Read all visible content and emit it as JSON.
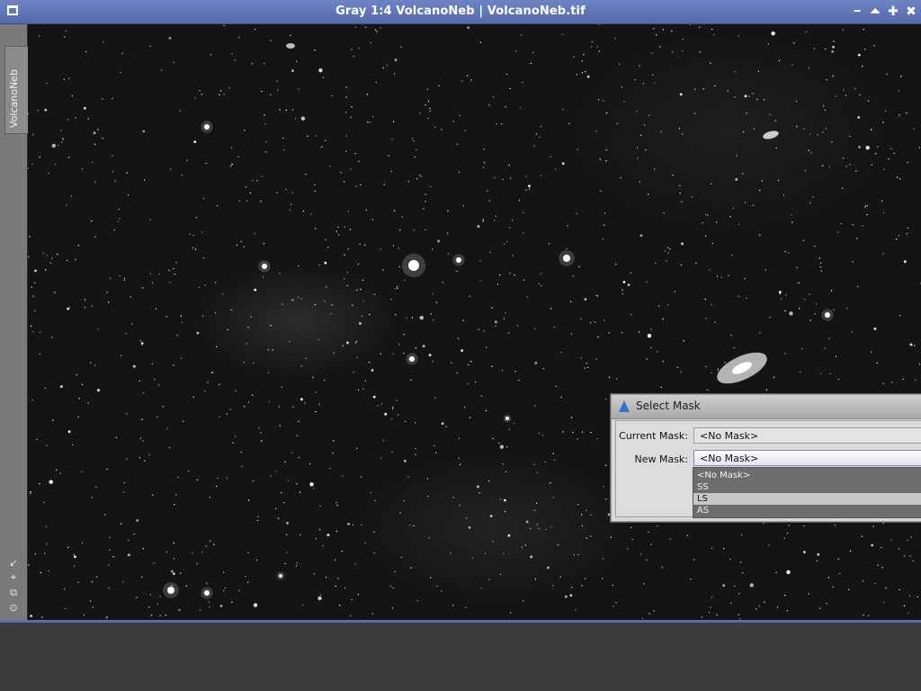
{
  "window": {
    "title": "Gray 1:4 VolcanoNeb | VolcanoNeb.tif",
    "tab_label": "VolcanoNeb",
    "buttons": {
      "minimize": "▬",
      "shade": "⏶",
      "maximize": "✚",
      "close": "✖"
    }
  },
  "sidebar_icons": [
    "arrow-icon",
    "crosshair-icon",
    "copy-icon",
    "target-icon"
  ],
  "dialog": {
    "title": "Select Mask",
    "current_mask_label": "Current Mask:",
    "current_mask_value": "<No Mask>",
    "new_mask_label": "New Mask:",
    "new_mask_value": "<No Mask>",
    "options": [
      "<No Mask>",
      "SS",
      "LS",
      "AS"
    ],
    "highlighted_option": "LS"
  },
  "colors": {
    "titlebar": "#5a6fae",
    "canvas": "#141414",
    "dialog": "#d8d8d8"
  }
}
